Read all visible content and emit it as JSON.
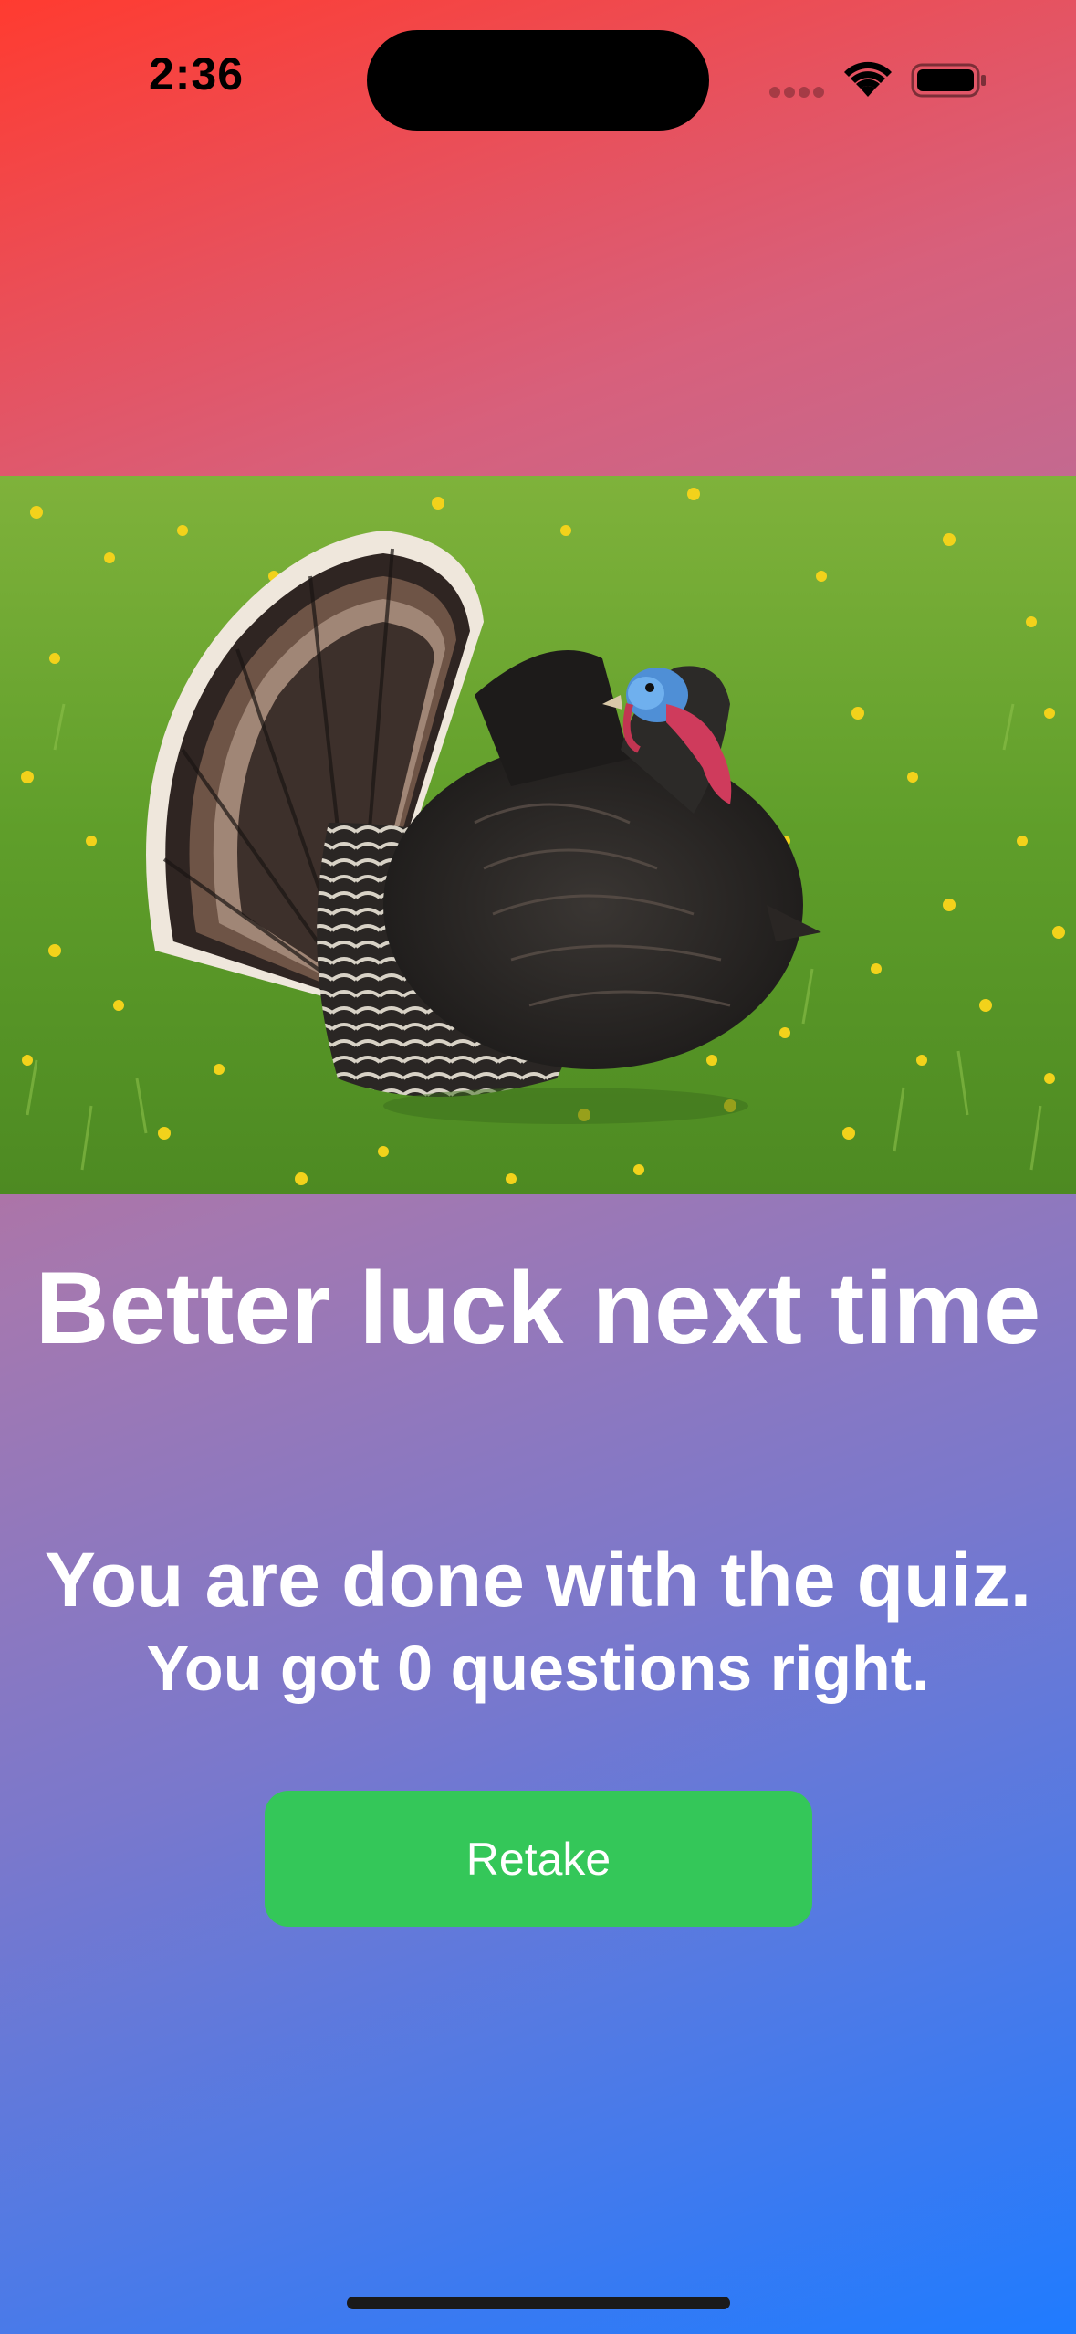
{
  "status_bar": {
    "time": "2:36",
    "icons": [
      "signal-icon",
      "wifi-icon",
      "battery-icon"
    ]
  },
  "hero": {
    "image": "wild turkey displaying tail feathers on grass with yellow dandelions"
  },
  "result": {
    "title": "Better luck next time",
    "done_message": "You are done with the quiz.",
    "score_message": "You got 0 questions right."
  },
  "actions": {
    "retake_label": "Retake"
  },
  "colors": {
    "gradient_top": "#ff3b30",
    "gradient_bottom": "#1f7bff",
    "button": "#34c759",
    "text": "#ffffff"
  }
}
